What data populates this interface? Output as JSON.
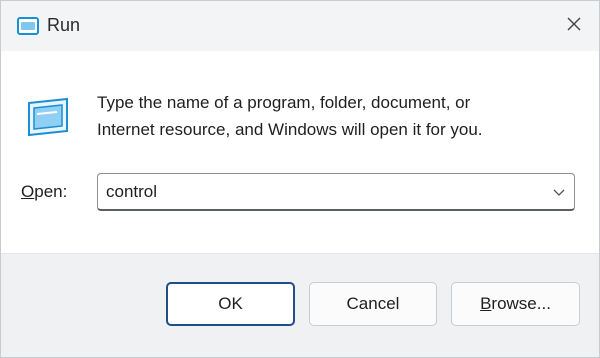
{
  "window": {
    "title": "Run",
    "close_icon": "close-icon",
    "app_icon": "run-icon"
  },
  "dialog": {
    "description_line1": "Type the name of a program, folder, document, or",
    "description_line2": "Internet resource, and Windows will open it for you.",
    "open_label_accel": "O",
    "open_label_rest": "pen:",
    "open_value": "control"
  },
  "buttons": {
    "ok": "OK",
    "cancel": "Cancel",
    "browse_accel": "B",
    "browse_rest": "rowse..."
  },
  "colors": {
    "title_bar": "#f3f4f6",
    "footer": "#f0f1f3",
    "default_button_border": "#1e4f88",
    "icon_accent": "#1a8fd6"
  }
}
